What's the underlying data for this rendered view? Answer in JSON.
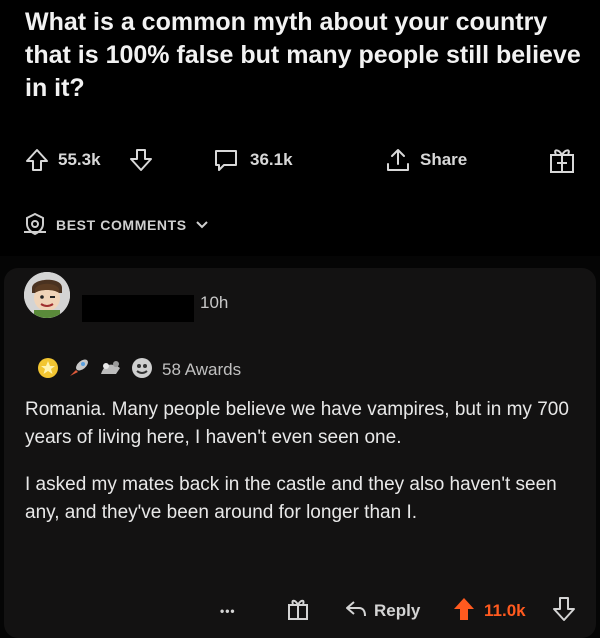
{
  "post": {
    "title": "What is a common myth about your country that is 100% false but many people still believe in it?",
    "upvotes": "55.3k",
    "comments": "36.1k",
    "share_label": "Share"
  },
  "sort": {
    "label": "BEST COMMENTS"
  },
  "comment": {
    "time": "10h",
    "awards_label": "58 Awards",
    "paragraphs": [
      "Romania. Many people believe we have vampires, but in my 700 years of living here, I haven't even seen one.",
      "I asked my mates back in the castle and they also haven't seen any, and they've been around for longer than I."
    ],
    "more_label": "•••",
    "reply_label": "Reply",
    "score": "11.0k",
    "score_color": "#ff5a1f"
  },
  "icons": [
    "upvote-icon",
    "downvote-icon",
    "comment-icon",
    "share-icon",
    "award-icon",
    "moderator-icon",
    "chevron-down-icon",
    "gold-award-icon",
    "reply-icon"
  ]
}
